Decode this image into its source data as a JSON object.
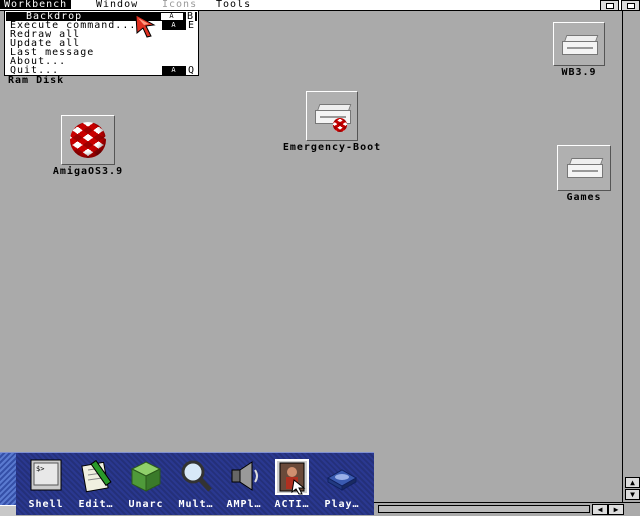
{
  "screen": {
    "menus": [
      {
        "label": "Workbench"
      },
      {
        "label": "Window"
      },
      {
        "label": "Icons"
      },
      {
        "label": "Tools"
      }
    ]
  },
  "workbench_menu": {
    "items": [
      {
        "label": "Backdrop",
        "key": "B"
      },
      {
        "label": "Execute command...",
        "key": "E"
      },
      {
        "label": "Redraw all",
        "key": ""
      },
      {
        "label": "Update all",
        "key": ""
      },
      {
        "label": "Last message",
        "key": ""
      },
      {
        "label": "About...",
        "key": ""
      },
      {
        "label": "Quit...",
        "key": "Q"
      }
    ]
  },
  "desktop": {
    "icons": [
      {
        "label": "Ram Disk",
        "icon": "ram-disk-icon"
      },
      {
        "label": "WB3.9",
        "icon": "hard-drive-icon"
      },
      {
        "label": "Emergency-Boot",
        "icon": "boot-drive-icon"
      },
      {
        "label": "AmigaOS3.9",
        "icon": "boing-ball-icon"
      },
      {
        "label": "Games",
        "icon": "hard-drive-icon"
      }
    ]
  },
  "dock": {
    "items": [
      {
        "label": "Shell",
        "icon": "shell-icon"
      },
      {
        "label": "Edit…",
        "icon": "notepad-icon"
      },
      {
        "label": "Unarc",
        "icon": "archive-cube-icon"
      },
      {
        "label": "Mult…",
        "icon": "magnifier-icon"
      },
      {
        "label": "AMPl…",
        "icon": "speaker-icon"
      },
      {
        "label": "ACTI…",
        "icon": "portrait-icon"
      },
      {
        "label": "Play…",
        "icon": "disc-player-icon"
      }
    ]
  },
  "colors": {
    "desktop": "#aaaaaa",
    "dock": "#2a3890",
    "menu_bg": "#ffffff",
    "boing_red": "#c80000"
  }
}
